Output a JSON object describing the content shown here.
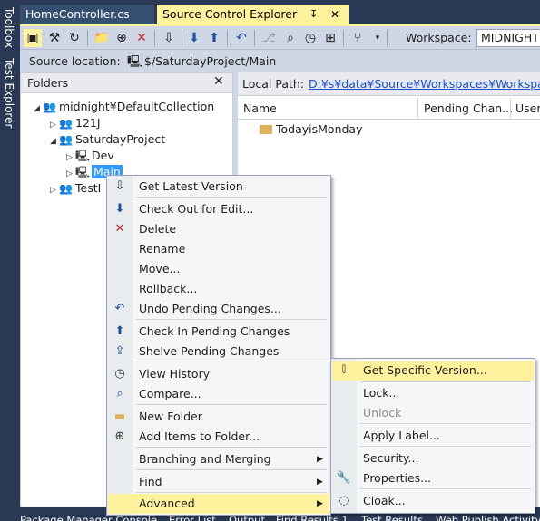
{
  "side_tabs": [
    "Toolbox",
    "Test Explorer"
  ],
  "doc_tabs": {
    "home": "HomeController.cs",
    "source_control": "Source Control Explorer",
    "pin_glyph": "↧",
    "close_glyph": "✕"
  },
  "toolbar": {
    "workspace_label": "Workspace:",
    "workspace_value": "MIDNIGHT"
  },
  "source_location": {
    "label": "Source location:",
    "path": "$/SaturdayProject/Main"
  },
  "folders": {
    "title": "Folders",
    "close_glyph": "✕",
    "tree": [
      {
        "label": "midnight¥DefaultCollection",
        "expanded": true
      },
      {
        "label": "121J",
        "expanded": false
      },
      {
        "label": "SaturdayProject",
        "expanded": true
      },
      {
        "label": "Dev",
        "expanded": false
      },
      {
        "label": "Main",
        "expanded": false,
        "selected": true
      },
      {
        "label": "TestI",
        "expanded": false
      }
    ]
  },
  "right_pane": {
    "local_path_label": "Local Path:",
    "local_path_value": "D:¥s¥data¥Source¥Workspaces¥Workspace",
    "columns": [
      "Name",
      "Pending Chan...",
      "User"
    ],
    "rows": [
      {
        "name": "TodayisMonday"
      }
    ]
  },
  "context_menu": {
    "items": [
      {
        "label": "Get Latest Version",
        "icon": "get-latest-icon"
      },
      {
        "label": "Check Out for Edit...",
        "icon": "check-out-icon"
      },
      {
        "label": "Delete",
        "icon": "delete-icon"
      },
      {
        "label": "Rename"
      },
      {
        "label": "Move..."
      },
      {
        "label": "Rollback..."
      },
      {
        "label": "Undo Pending Changes...",
        "icon": "undo-icon"
      },
      {
        "label": "Check In Pending Changes",
        "icon": "check-in-icon"
      },
      {
        "label": "Shelve Pending Changes",
        "icon": "shelve-icon"
      },
      {
        "label": "View History",
        "icon": "history-icon"
      },
      {
        "label": "Compare...",
        "icon": "compare-icon"
      },
      {
        "label": "New Folder",
        "icon": "new-folder-icon"
      },
      {
        "label": "Add Items to Folder...",
        "icon": "add-items-icon"
      },
      {
        "label": "Branching and Merging",
        "submenu": true
      },
      {
        "label": "Find",
        "submenu": true
      },
      {
        "label": "Advanced",
        "submenu": true,
        "highlighted": true
      }
    ]
  },
  "advanced_submenu": {
    "items": [
      {
        "label": "Get Specific Version...",
        "icon": "get-specific-icon",
        "highlighted": true
      },
      {
        "label": "Lock..."
      },
      {
        "label": "Unlock",
        "disabled": true
      },
      {
        "label": "Apply Label..."
      },
      {
        "label": "Security..."
      },
      {
        "label": "Properties...",
        "icon": "wrench-icon"
      },
      {
        "label": "Cloak...",
        "icon": "cloak-icon"
      }
    ]
  },
  "bottom_tabs": [
    "Package Manager Console",
    "Error List",
    "Output",
    "Find Results 1",
    "Test Results",
    "Web Publish Activity"
  ],
  "colors": {
    "accent_yellow": "#fff29d",
    "chrome_dark": "#293955",
    "toolbar": "#cfd6e5",
    "selection_blue": "#3399ff"
  }
}
